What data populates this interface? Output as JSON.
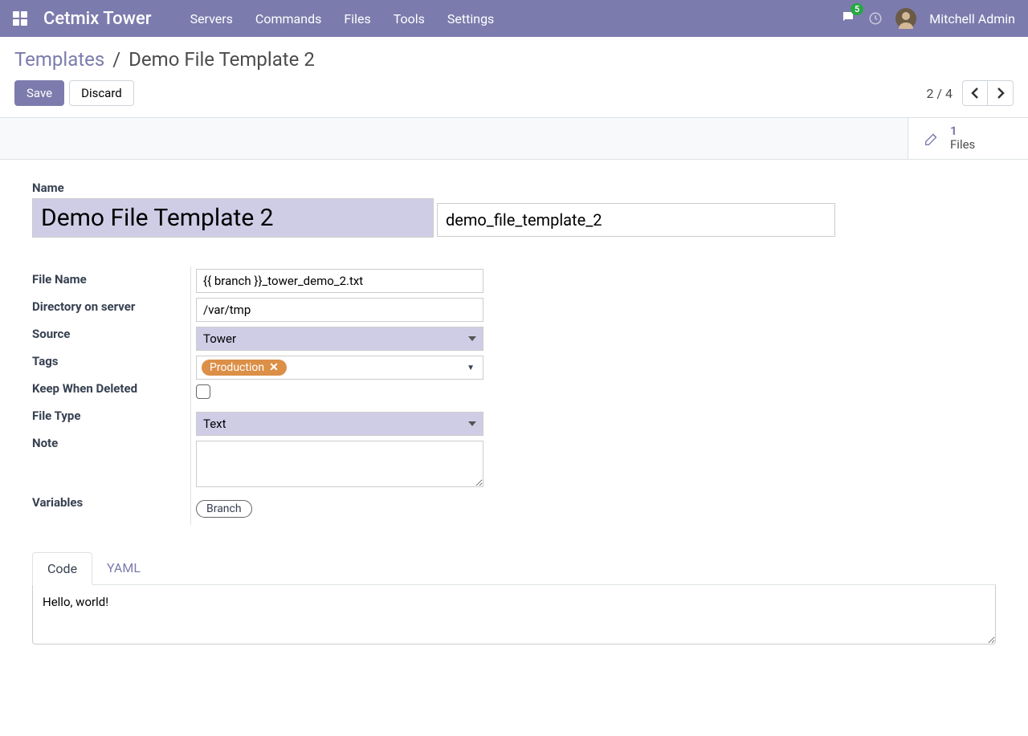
{
  "nav": {
    "app_title": "Cetmix Tower",
    "links": [
      "Servers",
      "Commands",
      "Files",
      "Tools",
      "Settings"
    ],
    "badge": "5",
    "user": "Mitchell Admin"
  },
  "breadcrumb": {
    "root": "Templates",
    "sep": "/",
    "current": "Demo File Template 2"
  },
  "actions": {
    "save": "Save",
    "discard": "Discard",
    "pager": "2 / 4"
  },
  "stat": {
    "count": "1",
    "label": "Files"
  },
  "form": {
    "name_label": "Name",
    "name_value": "Demo File Template 2",
    "reference_value": "demo_file_template_2",
    "labels": {
      "file_name": "File Name",
      "dir": "Directory on server",
      "source": "Source",
      "tags": "Tags",
      "keep": "Keep When Deleted",
      "file_type": "File Type",
      "note": "Note",
      "variables": "Variables"
    },
    "values": {
      "file_name": "{{ branch }}_tower_demo_2.txt",
      "dir": "/var/tmp",
      "source": "Tower",
      "tag": "Production",
      "file_type": "Text",
      "note": "",
      "variable": "Branch"
    }
  },
  "tabs": {
    "code": "Code",
    "yaml": "YAML"
  },
  "code_content": "Hello, world!"
}
